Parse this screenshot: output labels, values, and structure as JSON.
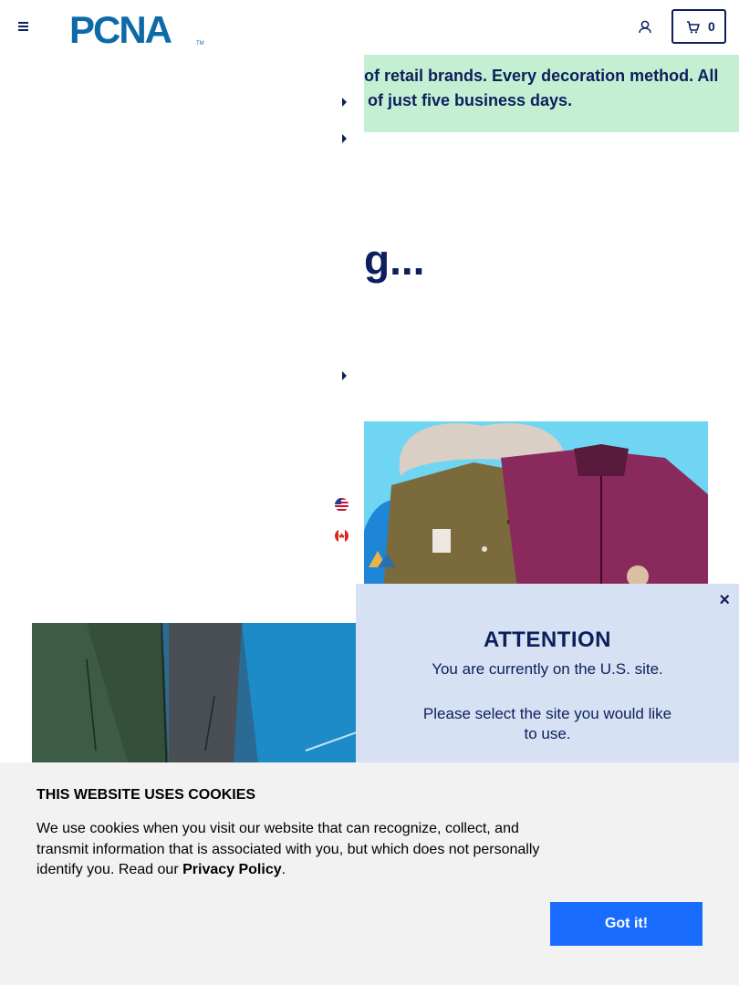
{
  "header": {
    "menu_icon": "hamburger-icon",
    "logo_text": "PCNA",
    "logo_tm": "TM",
    "account_icon": "user-icon",
    "cart_icon": "cart-icon",
    "cart_count": "0"
  },
  "background_page": {
    "banner_line1": "of retail brands. Every decoration method. All",
    "banner_line2": "of just five business days.",
    "heading_fragment": "g..."
  },
  "menu": {
    "caret_icon": "caret-right-icon",
    "flags": [
      "us-flag-icon",
      "canada-flag-icon"
    ]
  },
  "attention": {
    "close_label": "×",
    "title": "ATTENTION",
    "line1": "You are currently on the U.S. site.",
    "line2": "Please select the site you would like to use."
  },
  "cookies": {
    "title": "THIS WEBSITE USES COOKIES",
    "text_before_link": "We use cookies when you visit our website that can recognize, collect, and transmit information that is associated with you, but which does not personally identify you. Read our ",
    "link_label": "Privacy Policy",
    "text_after_link": ".",
    "button_label": "Got it!"
  },
  "colors": {
    "brand_navy": "#0d1f5c",
    "banner_green": "#c4efd2",
    "modal_blue": "#d6e2f3",
    "button_blue": "#1a6cff"
  }
}
